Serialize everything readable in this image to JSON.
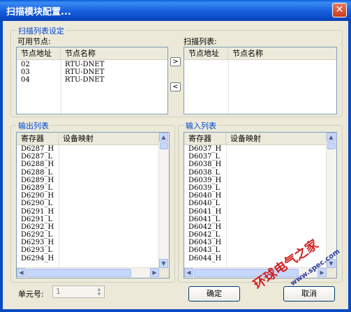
{
  "window": {
    "title": "扫描模块配置...",
    "close_glyph": "✕"
  },
  "scan_group": {
    "label": "扫描列表设定",
    "available_label": "可用节点:",
    "scan_list_label": "扫描列表:",
    "columns": [
      "节点地址",
      "节点名称"
    ],
    "available_rows": [
      {
        "addr": "02",
        "name": "RTU-DNET"
      },
      {
        "addr": "03",
        "name": "RTU-DNET"
      },
      {
        "addr": "04",
        "name": "RTU-DNET"
      }
    ],
    "scan_rows": [],
    "move_right": ">",
    "move_left": "<"
  },
  "output_group": {
    "label": "输出列表",
    "columns": [
      "寄存器",
      "设备映射"
    ],
    "rows": [
      "D6287_H",
      "D6287_L",
      "D6288_H",
      "D6288_L",
      "D6289_H",
      "D6289_L",
      "D6290_H",
      "D6290_L",
      "D6291_H",
      "D6291_L",
      "D6292_H",
      "D6292_L",
      "D6293_H",
      "D6293_L",
      "D6294_H"
    ]
  },
  "input_group": {
    "label": "输入列表",
    "columns": [
      "寄存器",
      "设备映射"
    ],
    "rows": [
      "D6037_H",
      "D6037_L",
      "D6038_H",
      "D6038_L",
      "D6039_H",
      "D6039_L",
      "D6040_H",
      "D6040_L",
      "D6041_H",
      "D6041_L",
      "D6042_H",
      "D6042_L",
      "D6043_H",
      "D6043_L",
      "D6044_H"
    ]
  },
  "unit": {
    "label": "单元号:",
    "value": "1"
  },
  "buttons": {
    "ok": "确定",
    "cancel": "取消"
  },
  "watermark": {
    "text": "环球电气之家",
    "url": "www.spec.com"
  }
}
